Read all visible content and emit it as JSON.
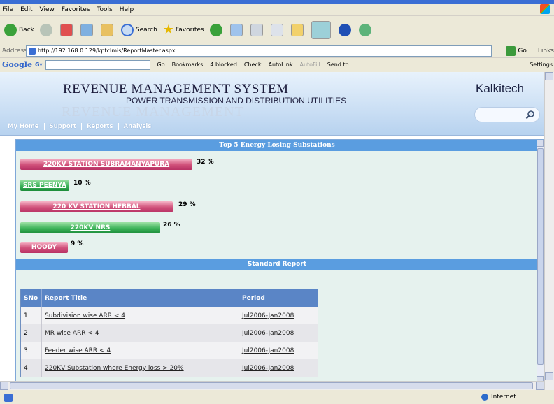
{
  "browser": {
    "menu": [
      "File",
      "Edit",
      "View",
      "Favorites",
      "Tools",
      "Help"
    ],
    "toolbar": {
      "back_label": "Back",
      "search_label": "Search",
      "favorites_label": "Favorites"
    },
    "address": {
      "label": "Address",
      "url": "http://192.168.0.129/kptclmis/ReportMaster.aspx",
      "go_label": "Go",
      "links_label": "Links"
    },
    "google_bar": {
      "logo": "Google",
      "go_label": "Go",
      "bookmarks_label": "Bookmarks",
      "blocked_label": "4 blocked",
      "check_label": "Check",
      "autolink_label": "AutoLink",
      "autofill_label": "AutoFill",
      "sendto_label": "Send to",
      "settings_label": "Settings"
    },
    "status": {
      "zone": "Internet"
    }
  },
  "banner": {
    "title": "REVENUE MANAGEMENT SYSTEM",
    "subtitle": "POWER TRANSMISSION AND DISTRIBUTION UTILITIES",
    "watermark": "REVENUE MANAGEMENT",
    "brand": "Kalkitech",
    "nav": [
      "My Home",
      "Support",
      "Reports",
      "Analysis"
    ]
  },
  "panel": {
    "top5_title": "Top 5 Energy Losing Substations",
    "standard_title": "Standard Report",
    "substations": [
      {
        "name": "220KV STATION SUBRAMANYAPURA",
        "percent_label": "32 %",
        "percent": 32,
        "status": "red"
      },
      {
        "name": "SRS PEENYA",
        "percent_label": "10 %",
        "percent": 10,
        "status": "green"
      },
      {
        "name": "220 KV STATION HEBBAL",
        "percent_label": "29 %",
        "percent": 29,
        "status": "red"
      },
      {
        "name": "220KV NRS",
        "percent_label": "26 %",
        "percent": 26,
        "status": "green"
      },
      {
        "name": "HOODY",
        "percent_label": "9 %",
        "percent": 9,
        "status": "red"
      }
    ],
    "colors": {
      "loss_bar": "#c8406e",
      "ok_bar": "#2fa24e",
      "header": "#5a9de0"
    }
  },
  "report_table": {
    "columns": [
      "SNo",
      "Report Title",
      "Period"
    ],
    "rows": [
      {
        "sno": "1",
        "title": "Subdivision wise ARR < 4",
        "period": "Jul2006-Jan2008"
      },
      {
        "sno": "2",
        "title": "MR wise ARR < 4",
        "period": "Jul2006-Jan2008"
      },
      {
        "sno": "3",
        "title": "Feeder wise ARR < 4",
        "period": "Jul2006-Jan2008"
      },
      {
        "sno": "4",
        "title": "220KV Substation where Energy loss > 20%",
        "period": "Jul2006-Jan2008"
      }
    ]
  }
}
